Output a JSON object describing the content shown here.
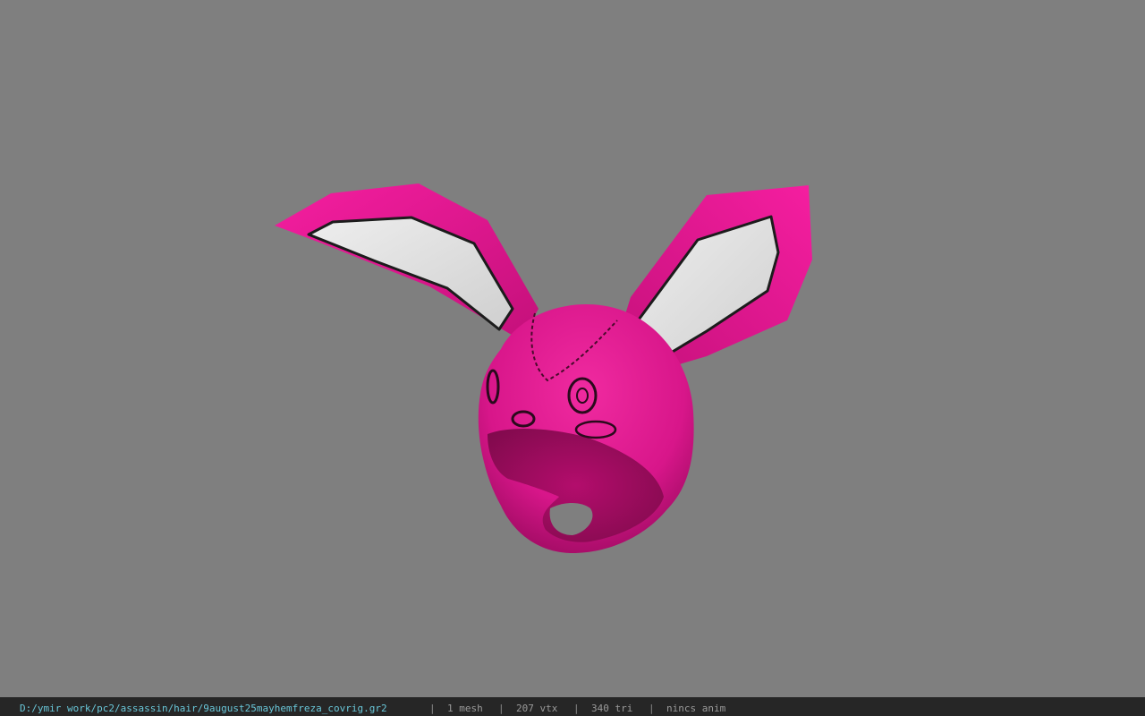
{
  "viewer": {
    "background_color": "#7f7f7f",
    "model_name": "pink bunny hood",
    "model_colors": {
      "fabric": "#e2198f",
      "fabric_dark": "#b80f72",
      "ear_inner": "#dedede",
      "stitch": "#1f1f1f"
    }
  },
  "status_bar": {
    "file_path": "D:/ymir work/pc2/assassin/hair/9august25mayhemfreza_covrig.gr2",
    "separator": "|",
    "mesh_count": "1 mesh",
    "vertex_count": "207 vtx",
    "triangle_count": "340 tri",
    "anim_status": "nincs anim"
  }
}
